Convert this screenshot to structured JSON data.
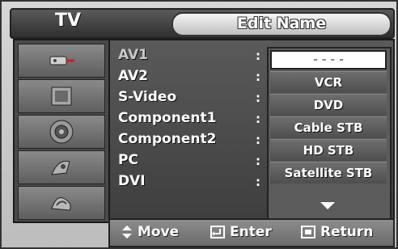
{
  "header": {
    "left_label": "TV",
    "title": "Edit Name"
  },
  "sidebar": {
    "icons": [
      "input-icon",
      "picture-icon",
      "sound-icon",
      "channel-icon",
      "setup-icon"
    ]
  },
  "sources": [
    {
      "label": "AV1",
      "selected": true
    },
    {
      "label": "AV2",
      "selected": false
    },
    {
      "label": "S-Video",
      "selected": false
    },
    {
      "label": "Component1",
      "selected": false
    },
    {
      "label": "Component2",
      "selected": false
    },
    {
      "label": "PC",
      "selected": false
    },
    {
      "label": "DVI",
      "selected": false
    }
  ],
  "separator": ":",
  "name_dropdown": {
    "current_value": "- - - -",
    "options": [
      "VCR",
      "DVD",
      "Cable STB",
      "HD STB",
      "Satellite STB"
    ]
  },
  "footer": {
    "move_label": "Move",
    "enter_label": "Enter",
    "return_label": "Return"
  }
}
